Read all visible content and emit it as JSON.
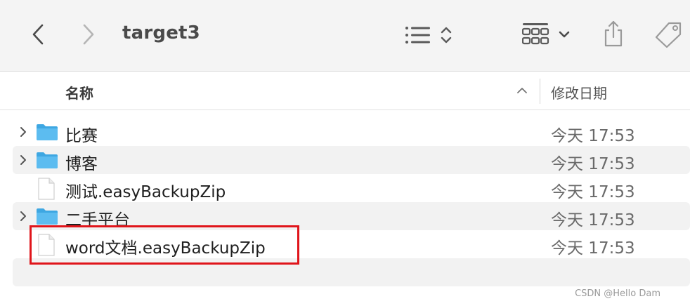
{
  "window": {
    "title": "target3"
  },
  "columns": {
    "name": "名称",
    "date": "修改日期"
  },
  "files": [
    {
      "name": "比赛",
      "kind": "folder",
      "date": "今天 17:53",
      "icon": "folder-icon"
    },
    {
      "name": "博客",
      "kind": "folder",
      "date": "今天 17:53",
      "icon": "folder-icon"
    },
    {
      "name": "测试.easyBackupZip",
      "kind": "file",
      "date": "今天 17:53",
      "icon": "document-icon"
    },
    {
      "name": "二手平台",
      "kind": "folder",
      "date": "今天 17:53",
      "icon": "folder-icon"
    },
    {
      "name": "word文档.easyBackupZip",
      "kind": "file",
      "date": "今天 17:53",
      "icon": "document-icon"
    }
  ],
  "watermark": "CSDN @Hello Dam",
  "colors": {
    "folder": "#4fb3ea",
    "highlight": "#e0151b",
    "toolbar": "#f4f4f4"
  }
}
